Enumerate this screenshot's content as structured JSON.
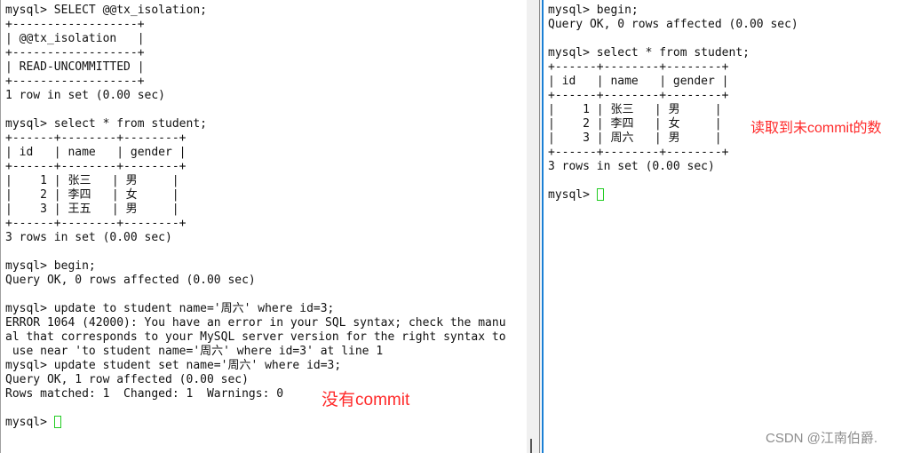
{
  "left_terminal": {
    "lines": [
      "mysql> SELECT @@tx_isolation;",
      "+------------------+",
      "| @@tx_isolation   |",
      "+------------------+",
      "| READ-UNCOMMITTED |",
      "+------------------+",
      "1 row in set (0.00 sec)",
      "",
      "mysql> select * from student;",
      "+------+--------+--------+",
      "| id   | name   | gender |",
      "+------+--------+--------+",
      "|    1 | 张三   | 男     |",
      "|    2 | 李四   | 女     |",
      "|    3 | 王五   | 男     |",
      "+------+--------+--------+",
      "3 rows in set (0.00 sec)",
      "",
      "mysql> begin;",
      "Query OK, 0 rows affected (0.00 sec)",
      "",
      "mysql> update to student name='周六' where id=3;",
      "ERROR 1064 (42000): You have an error in your SQL syntax; check the manu",
      "al that corresponds to your MySQL server version for the right syntax to",
      " use near 'to student name='周六' where id=3' at line 1",
      "mysql> update student set name='周六' where id=3;",
      "Query OK, 1 row affected (0.00 sec)",
      "Rows matched: 1  Changed: 1  Warnings: 0",
      ""
    ],
    "prompt": "mysql> "
  },
  "right_terminal": {
    "lines": [
      "mysql> begin;",
      "Query OK, 0 rows affected (0.00 sec)",
      "",
      "mysql> select * from student;",
      "+------+--------+--------+",
      "| id   | name   | gender |",
      "+------+--------+--------+",
      "|    1 | 张三   | 男     |",
      "|    2 | 李四   | 女     |",
      "|    3 | 周六   | 男     |",
      "+------+--------+--------+",
      "3 rows in set (0.00 sec)",
      ""
    ],
    "prompt": "mysql> "
  },
  "annotations": {
    "left": "没有commit",
    "right": "读取到未commit的数"
  },
  "watermark": "CSDN @江南伯爵.",
  "colors": {
    "annotation": "#ff2a2a",
    "cursor": "#22cc22",
    "active_pane_border": "#1a7fd4"
  }
}
